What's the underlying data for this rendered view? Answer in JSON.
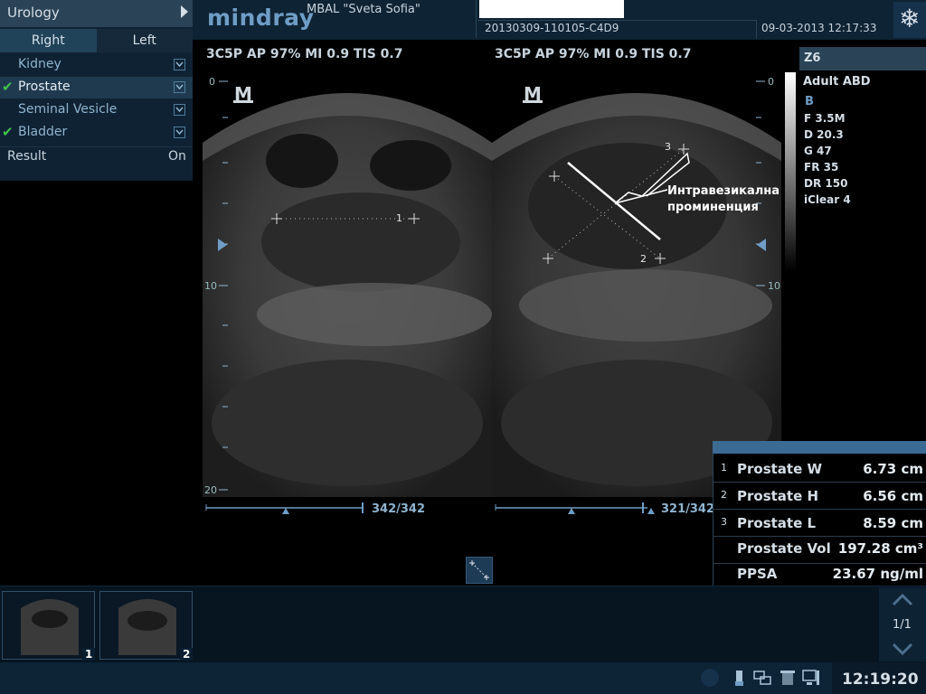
{
  "app": {
    "menu_title": "Urology",
    "brand": "mindray",
    "hospital": "MBAL \"Sveta Sofia\"",
    "exam_id": "20130309-110105-C4D9",
    "datetime": "09-03-2013  12:17:33"
  },
  "sidebar": {
    "tabs": [
      {
        "label": "Right",
        "active": true
      },
      {
        "label": "Left",
        "active": false
      }
    ],
    "items": [
      {
        "label": "Kidney",
        "checked": false
      },
      {
        "label": "Prostate",
        "checked": true
      },
      {
        "label": "Seminal Vesicle",
        "checked": false
      },
      {
        "label": "Bladder",
        "checked": true
      }
    ],
    "result_label": "Result",
    "result_value": "On"
  },
  "images": {
    "left_params": "3C5P  AP 97%  MI 0.9 TIS 0.7",
    "right_params": "3C5P  AP 97%  MI 0.9 TIS 0.7",
    "marker": "M",
    "depth_top": "0",
    "depth_mid": "10",
    "depth_bottom": "20",
    "left_frame": "342/342",
    "right_frame": "321/342",
    "measure_left": "1",
    "measure_right_a": "2",
    "measure_right_b": "3",
    "annotation_line1": "Интравезикална",
    "annotation_line2": "проминенция"
  },
  "info": {
    "probe": "Z6",
    "preset": "Adult ABD",
    "mode": "B",
    "params": [
      "F 3.5M",
      "D 20.3",
      "G 47",
      "FR 35",
      "DR 150",
      "iClear 4"
    ]
  },
  "results": {
    "rows": [
      {
        "idx": "1",
        "name": "Prostate W",
        "value": "6.73 cm"
      },
      {
        "idx": "2",
        "name": "Prostate H",
        "value": "6.56 cm"
      },
      {
        "idx": "3",
        "name": "Prostate L",
        "value": "8.59 cm"
      },
      {
        "idx": "",
        "name": "Prostate Vol",
        "value": "197.28 cm³"
      },
      {
        "idx": "",
        "name": "PPSA",
        "value": "23.67 ng/ml"
      }
    ]
  },
  "thumbnails": [
    {
      "num": "1"
    },
    {
      "num": "2"
    }
  ],
  "pager": {
    "label": "1/1"
  },
  "status": {
    "clock": "12:19:20"
  },
  "colors": {
    "accent": "#3b6a92",
    "panel": "#2a4356",
    "check": "#42c34a"
  },
  "icons": [
    "snowflake-icon",
    "usb-icon",
    "network-icon",
    "trash-icon",
    "monitor-icon",
    "measure-icon"
  ]
}
